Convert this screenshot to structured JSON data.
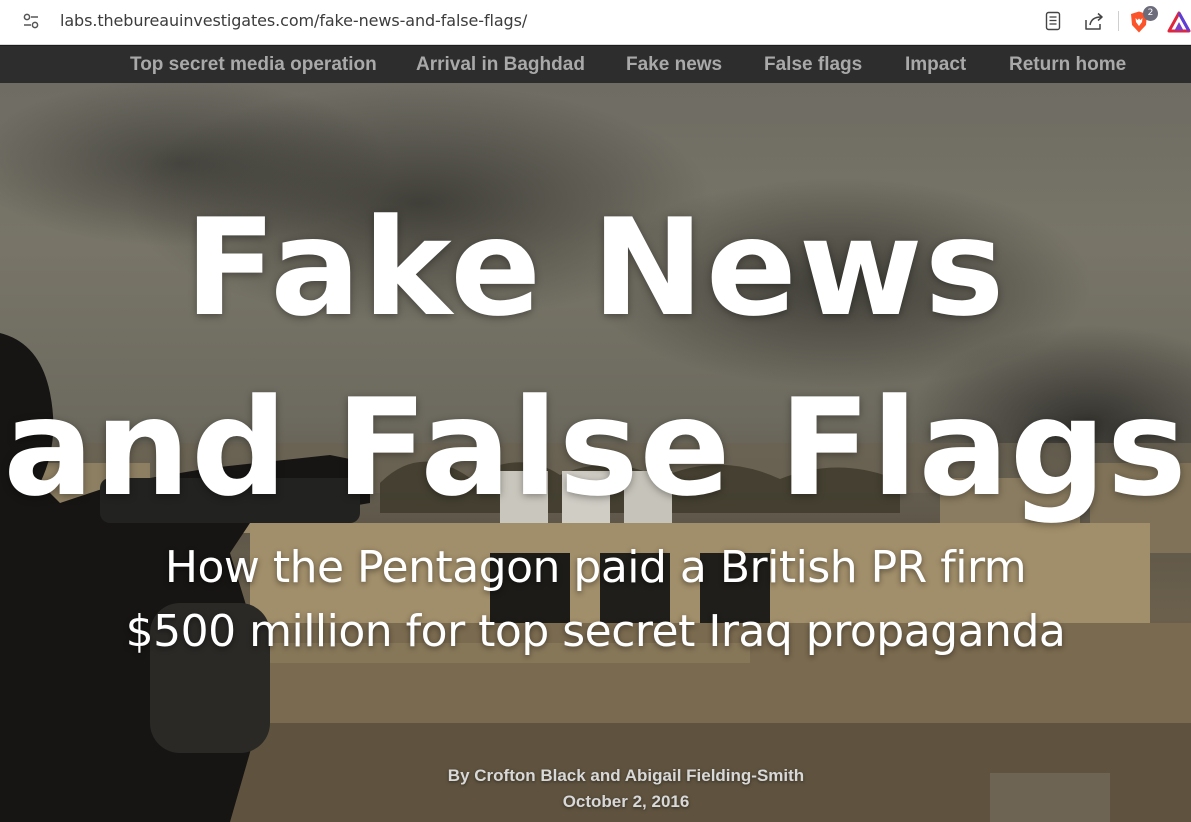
{
  "browser": {
    "url": "labs.thebureauinvestigates.com/fake-news-and-false-flags/",
    "shield_count": "2",
    "colors": {
      "brave_orange": "#fb542b",
      "rewards_red": "#e0263c",
      "rewards_purple": "#5a3fd8"
    },
    "icons": [
      "site-info-icon",
      "reader-mode-icon",
      "share-icon",
      "brave-shields-icon",
      "brave-rewards-icon"
    ]
  },
  "nav": {
    "items": [
      "Top secret media operation",
      "Arrival in Baghdad",
      "Fake news",
      "False flags",
      "Impact",
      "Return home"
    ]
  },
  "hero": {
    "title_line1": "Fake News",
    "title_line2": "and False Flags",
    "subtitle_line1": "How the Pentagon paid a British PR firm",
    "subtitle_line2": "$500 million for top secret Iraq propaganda",
    "byline": "By Crofton Black and Abigail Fielding-Smith",
    "date": "October 2, 2016"
  }
}
